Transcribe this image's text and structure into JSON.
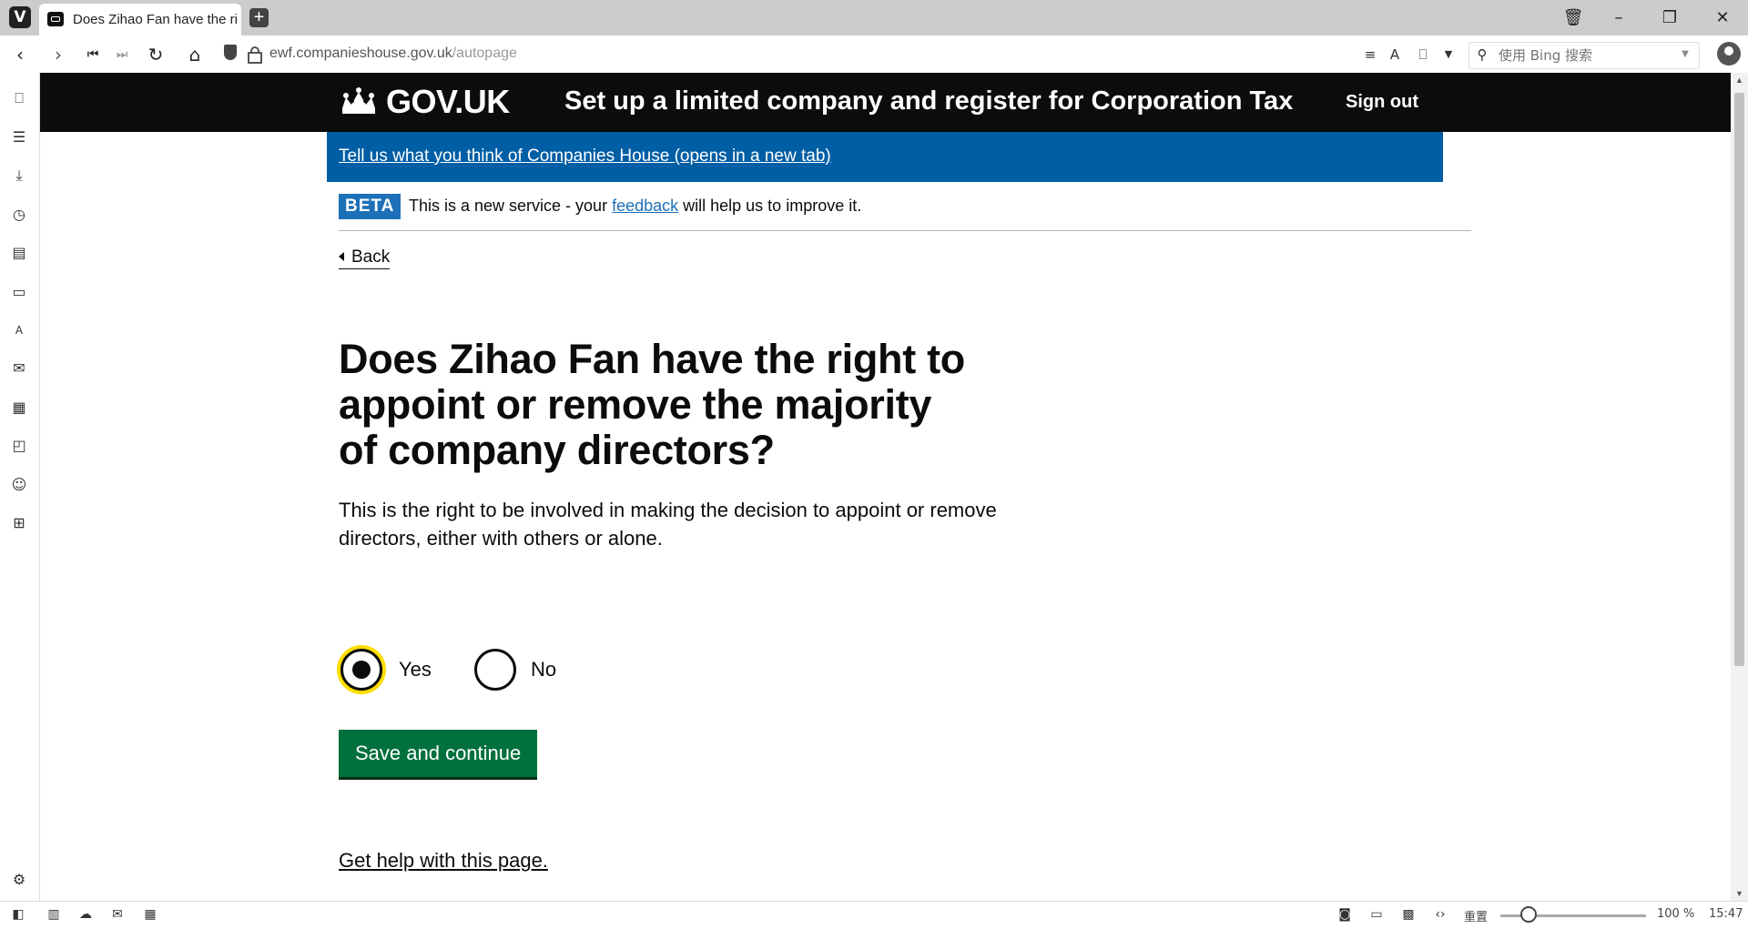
{
  "browser": {
    "tab_title": "Does Zihao Fan have the right to appoint or remove the majority of company directors?",
    "url_host": "ewf.companieshouse.gov.uk",
    "url_path": "/autopage",
    "search_placeholder": "使用 Bing 搜索",
    "zoom_reset_label": "重置",
    "zoom_level": "100 %",
    "clock": "15:47"
  },
  "header": {
    "logo": "GOV.UK",
    "service_name": "Set up a limited company and register for Corporation Tax",
    "sign_out": "Sign out"
  },
  "feedback_banner": {
    "link": "Tell us what you think of Companies House (opens in a new tab)"
  },
  "phase_banner": {
    "tag": "BETA",
    "text_before": "This is a new service - your ",
    "link": "feedback",
    "text_after": " will help us to improve it."
  },
  "back_link": "Back",
  "question": {
    "heading": "Does Zihao Fan have the right to appoint or remove the majority of company directors?",
    "hint": "This is the right to be involved in making the decision to appoint or remove directors, either with others or alone.",
    "options": [
      {
        "label": "Yes",
        "selected": true
      },
      {
        "label": "No",
        "selected": false
      }
    ]
  },
  "submit_button": "Save and continue",
  "help_link": "Get help with this page."
}
